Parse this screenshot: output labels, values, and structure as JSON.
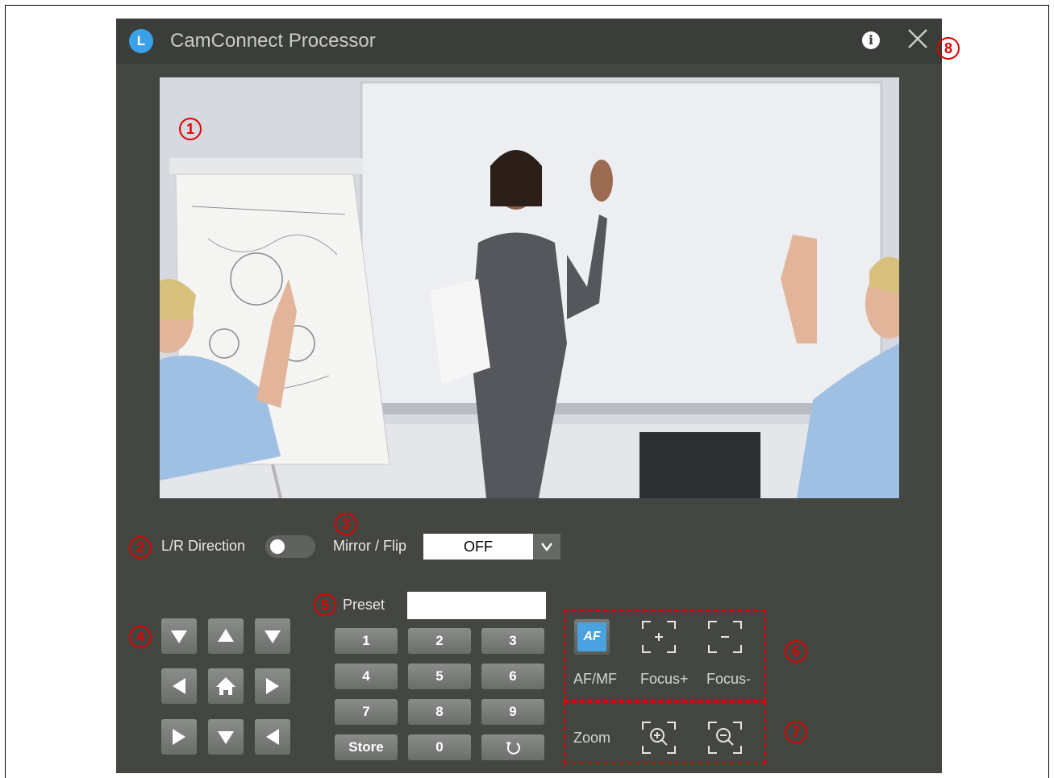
{
  "window": {
    "logo_letter": "L",
    "title": "CamConnect Processor"
  },
  "icons": {
    "info": "info-icon",
    "close": "close-icon"
  },
  "callouts": [
    "1",
    "2",
    "3",
    "4",
    "5",
    "6",
    "7",
    "8"
  ],
  "settings": {
    "lr_direction_label": "L/R Direction",
    "lr_direction_on": false,
    "mirror_flip_label": "Mirror / Flip",
    "mirror_flip_value": "OFF"
  },
  "preset": {
    "label": "Preset",
    "value": "",
    "keys": [
      "1",
      "2",
      "3",
      "4",
      "5",
      "6",
      "7",
      "8",
      "9",
      "Store",
      "0",
      "reset-icon"
    ]
  },
  "focus": {
    "af_badge": "AF",
    "af_label": "AF/MF",
    "focus_plus_label": "Focus+",
    "focus_minus_label": "Focus-"
  },
  "zoom": {
    "label": "Zoom"
  },
  "colors": {
    "window_bg": "#434641",
    "titlebar_bg": "#3b3d3a",
    "accent": "#3aa0e8",
    "callout": "#e00000"
  }
}
